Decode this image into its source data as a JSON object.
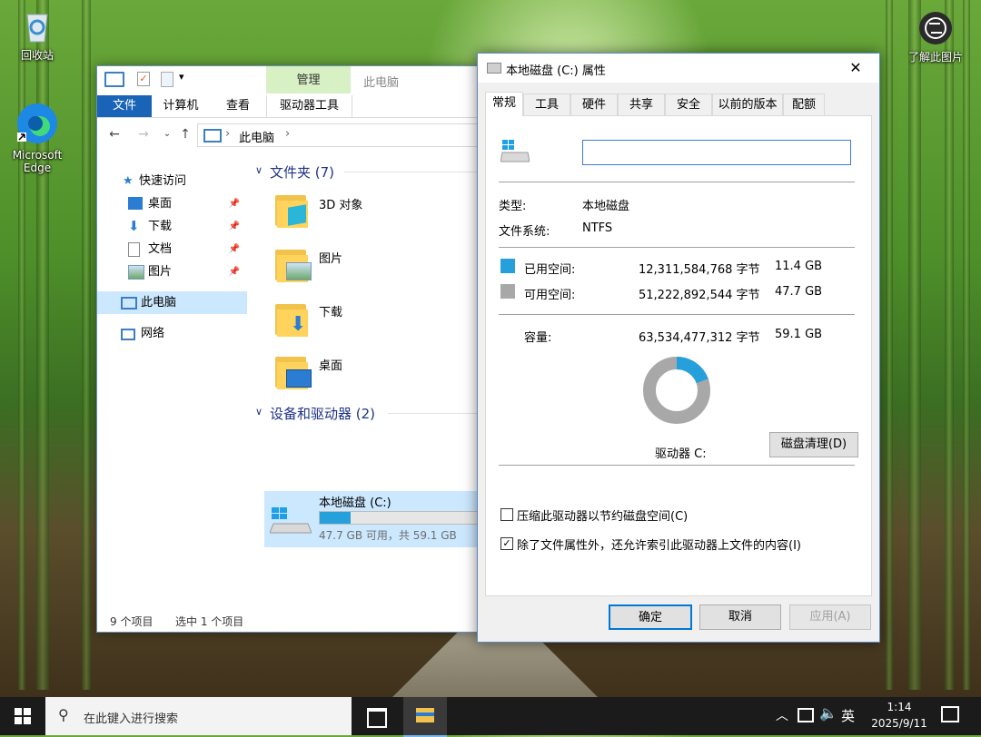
{
  "desktop": {
    "icons": [
      {
        "label": "回收站"
      },
      {
        "label": "Microsoft Edge"
      },
      {
        "label": "了解此图片"
      }
    ]
  },
  "explorer": {
    "ribbon_context_header": "管理",
    "window_title": "此电脑",
    "ribbon_tabs": [
      "文件",
      "计算机",
      "查看",
      "驱动器工具"
    ],
    "address_path": "此电脑",
    "sidebar": {
      "quick_access": "快速访问",
      "items": [
        {
          "label": "桌面",
          "pinned": true
        },
        {
          "label": "下载",
          "pinned": true
        },
        {
          "label": "文档",
          "pinned": true
        },
        {
          "label": "图片",
          "pinned": true
        }
      ],
      "this_pc": "此电脑",
      "network": "网络"
    },
    "folders_group": "文件夹 (7)",
    "folders": [
      "3D 对象",
      "图片",
      "下载",
      "桌面"
    ],
    "drives_group": "设备和驱动器 (2)",
    "drive": {
      "name": "本地磁盘 (C:)",
      "free_text": "47.7 GB 可用，共 59.1 GB",
      "used_fraction": 0.193
    },
    "status": {
      "items": "9 个项目",
      "selected": "选中 1 个项目"
    }
  },
  "properties": {
    "title": "本地磁盘 (C:) 属性",
    "tabs": [
      "常规",
      "工具",
      "硬件",
      "共享",
      "安全",
      "以前的版本",
      "配额"
    ],
    "name_value": "",
    "type_label": "类型:",
    "type_value": "本地磁盘",
    "fs_label": "文件系统:",
    "fs_value": "NTFS",
    "used_label": "已用空间:",
    "used_bytes": "12,311,584,768 字节",
    "used_gb": "11.4 GB",
    "free_label": "可用空间:",
    "free_bytes": "51,222,892,544 字节",
    "free_gb": "47.7 GB",
    "capacity_label": "容量:",
    "capacity_bytes": "63,534,477,312 字节",
    "capacity_gb": "59.1 GB",
    "drive_label": "驱动器 C:",
    "cleanup_button": "磁盘清理(D)",
    "compress_label": "压缩此驱动器以节约磁盘空间(C)",
    "compress_checked": false,
    "index_label": "除了文件属性外，还允许索引此驱动器上文件的内容(I)",
    "index_checked": true,
    "ok_button": "确定",
    "cancel_button": "取消",
    "apply_button": "应用(A)",
    "used_fraction": 0.194,
    "colors": {
      "used": "#26a0da",
      "free": "#a8a8a8"
    }
  },
  "taskbar": {
    "search_placeholder": "在此键入进行搜索",
    "ime": "英",
    "time": "1:14",
    "date": "2025/9/11"
  }
}
